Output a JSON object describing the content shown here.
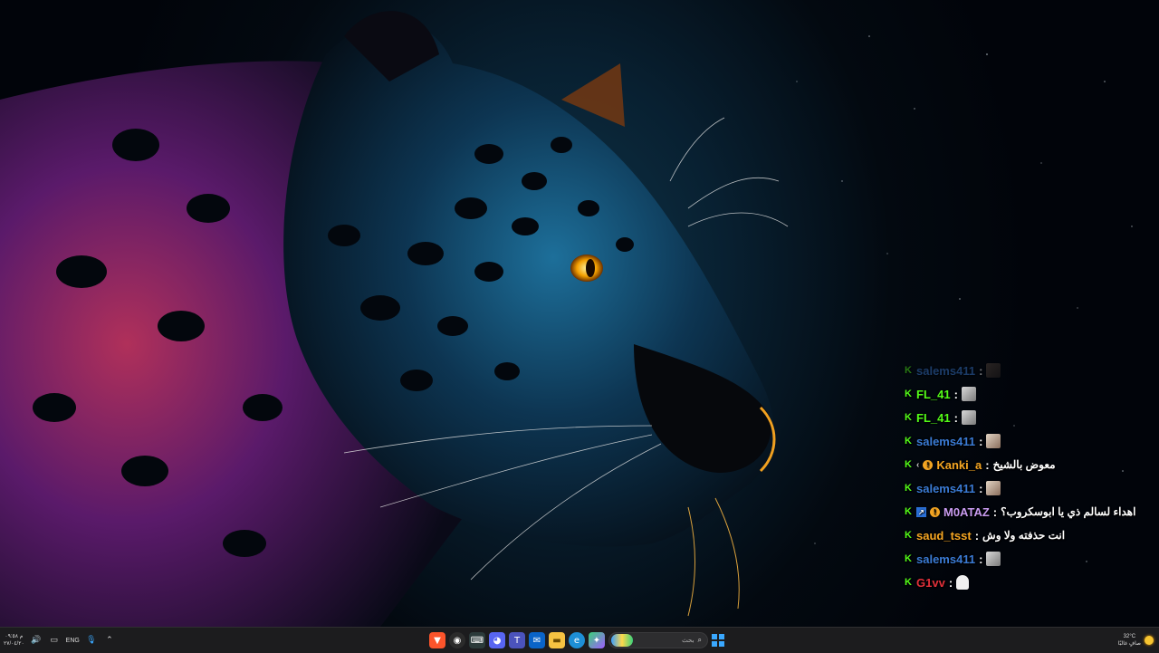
{
  "chat": {
    "messages": [
      {
        "user": "salems411",
        "user_color": "#3a7bd5",
        "sep": ":",
        "text": "",
        "emote": "dark-face-emote",
        "faded": true,
        "badges": []
      },
      {
        "user": "FL_41",
        "user_color": "#53fc18",
        "sep": ":",
        "text": "",
        "emote": "grey-face-emote",
        "faded": false,
        "badges": []
      },
      {
        "user": "FL_41",
        "user_color": "#53fc18",
        "sep": ":",
        "text": "",
        "emote": "grey-face-emote",
        "faded": false,
        "badges": []
      },
      {
        "user": "salems411",
        "user_color": "#3a7bd5",
        "sep": ":",
        "text": "",
        "emote": "face-emote",
        "faded": false,
        "badges": []
      },
      {
        "user": "Kanki_a",
        "user_color": "#f5a623",
        "sep": ":",
        "text": "معوض بالشيخ",
        "emote": "",
        "faded": false,
        "badges": [
          "chevron",
          "orange"
        ]
      },
      {
        "user": "salems411",
        "user_color": "#3a7bd5",
        "sep": ":",
        "text": "",
        "emote": "face-emote",
        "faded": false,
        "badges": []
      },
      {
        "user": "M0ATAZ",
        "user_color": "#c89bf0",
        "sep": ":",
        "text": "اهداء لسالم ذي يا ابوسكروب؟",
        "emote": "",
        "faded": false,
        "badges": [
          "blue",
          "orange"
        ]
      },
      {
        "user": "saud_tsst",
        "user_color": "#f5a623",
        "sep": ":",
        "text": "انت حذفته ولا وش",
        "emote": "",
        "faded": false,
        "badges": []
      },
      {
        "user": "salems411",
        "user_color": "#3a7bd5",
        "sep": ":",
        "text": "",
        "emote": "grey-face-emote",
        "faded": false,
        "badges": []
      },
      {
        "user": "G1vv",
        "user_color": "#e0303a",
        "sep": ":",
        "text": "",
        "emote": "ghost-emote",
        "faded": false,
        "badges": []
      }
    ]
  },
  "taskbar": {
    "clock_time": "م ٠٩:٥٨",
    "clock_date": "٢٧/٠٤/٢٠",
    "lang": "ENG",
    "search_placeholder": "بحث",
    "weather_temp": "32°C",
    "weather_desc": "صافٍ غالبًا",
    "colors": {
      "bar": "#1c1c1e",
      "accent": "#3aa8ff"
    }
  }
}
